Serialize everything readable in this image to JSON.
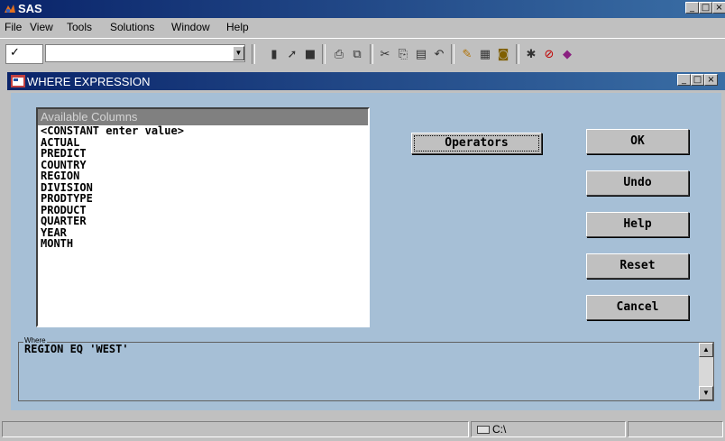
{
  "app": {
    "title": "SAS",
    "window_buttons": [
      "_",
      "□",
      "×"
    ]
  },
  "menu": [
    "File",
    "View",
    "Tools",
    "Solutions",
    "Window",
    "Help"
  ],
  "toolbar": {
    "command_check": "✓",
    "command_value": "",
    "icons": [
      "new-icon",
      "open-icon",
      "save-icon",
      "print-icon",
      "print-preview-icon",
      "cut-icon",
      "copy-icon",
      "paste-icon",
      "undo-icon",
      "explorer-icon",
      "results-icon",
      "library-icon",
      "run-icon",
      "submit-icon",
      "help-icon"
    ]
  },
  "dialog": {
    "title": "WHERE EXPRESSION",
    "list_header": "Available Columns",
    "columns": [
      "<CONSTANT enter value>",
      "ACTUAL",
      "PREDICT",
      "COUNTRY",
      "REGION",
      "DIVISION",
      "PRODTYPE",
      "PRODUCT",
      "QUARTER",
      "YEAR",
      "MONTH"
    ],
    "operators_label": "Operators",
    "buttons": {
      "ok": "OK",
      "undo": "Undo",
      "help": "Help",
      "reset": "Reset",
      "cancel": "Cancel"
    },
    "where_label": "Where",
    "where_expression": "REGION EQ 'WEST'"
  },
  "status": {
    "path": "C:\\"
  },
  "colors": {
    "titlebar": "#0a246a",
    "client_bg": "#a6bfd6",
    "chrome": "#c0c0c0"
  }
}
